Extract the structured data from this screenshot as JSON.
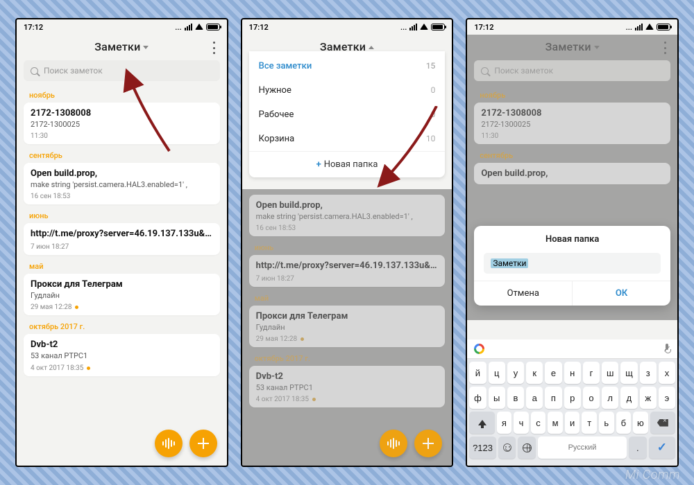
{
  "status": {
    "time": "17:12"
  },
  "header": {
    "title": "Заметки"
  },
  "search": {
    "placeholder": "Поиск заметок"
  },
  "sections": [
    {
      "label": "ноябрь",
      "notes": [
        {
          "title": "2172-1308008",
          "sub": "2172-1300025",
          "meta": "11:30",
          "dot": false
        }
      ]
    },
    {
      "label": "сентябрь",
      "notes": [
        {
          "title": "Open build.prop,",
          "sub": "make string 'persist.camera.HAL3.enabled=1' ,",
          "meta": "16 сен 18:53",
          "dot": false
        }
      ]
    },
    {
      "label": "июнь",
      "notes": [
        {
          "title": "http://t.me/proxy?server=46.19.137.133u&port...",
          "sub": "",
          "meta": "7 июн 18:27",
          "dot": false
        }
      ]
    },
    {
      "label": "май",
      "notes": [
        {
          "title": "Прокси для Телеграм",
          "sub": "Гудлайн",
          "meta": "29 мая 12:28",
          "dot": true
        }
      ]
    },
    {
      "label": "октябрь 2017 г.",
      "notes": [
        {
          "title": "Dvb-t2",
          "sub": "53 канал РТРС1",
          "meta": "4 окт 2017 18:35",
          "dot": true
        }
      ]
    }
  ],
  "folders": {
    "selected": "Все заметки",
    "items": [
      {
        "name": "Все заметки",
        "count": 15
      },
      {
        "name": "Нужное",
        "count": 0
      },
      {
        "name": "Рабочее",
        "count": 0
      },
      {
        "name": "Корзина",
        "count": 10
      }
    ],
    "new_label": "Новая папка",
    "plus": "+"
  },
  "dialog": {
    "title": "Новая папка",
    "value": "Заметки",
    "cancel": "Отмена",
    "ok": "ОК"
  },
  "keyboard": {
    "numeric_label": "?123",
    "space_label": "Русский",
    "rows": [
      [
        "й",
        "ц",
        "у",
        "к",
        "е",
        "н",
        "г",
        "ш",
        "щ",
        "з",
        "х"
      ],
      [
        "ф",
        "ы",
        "в",
        "а",
        "п",
        "р",
        "о",
        "л",
        "д",
        "ж",
        "э"
      ],
      [
        "я",
        "ч",
        "с",
        "м",
        "и",
        "т",
        "ь",
        "б",
        "ю"
      ]
    ]
  },
  "watermark": "Mi Comm"
}
